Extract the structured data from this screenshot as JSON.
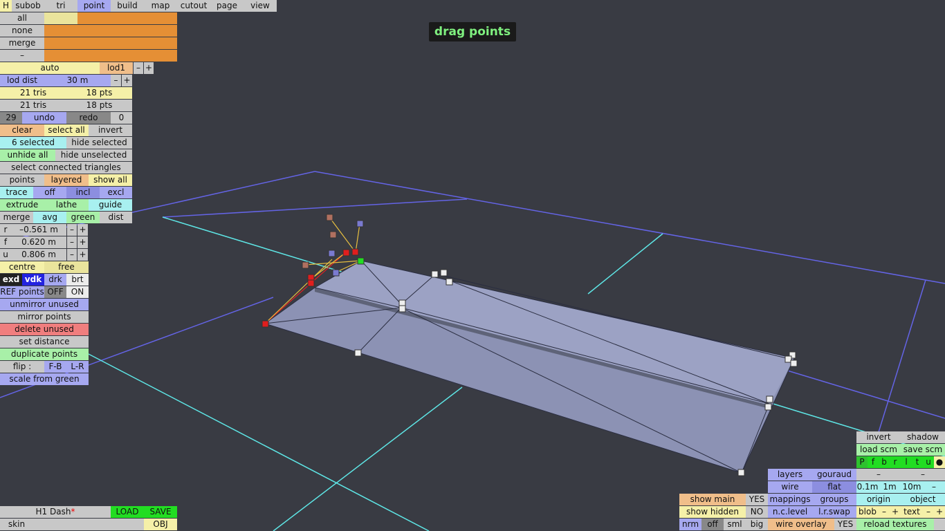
{
  "tabs": [
    "H",
    "subob",
    "tri",
    "point",
    "build",
    "map",
    "cutout",
    "page",
    "view"
  ],
  "selection_rows": [
    "all",
    "none",
    "merge",
    "–"
  ],
  "lod": {
    "auto": "auto",
    "level": "lod1",
    "dist_label": "lod dist",
    "dist_value": "30 m",
    "minus": "–",
    "plus": "+"
  },
  "stats": {
    "tris_a": "21 tris",
    "pts_a": "18 pts",
    "tris_b": "21 tris",
    "pts_b": "18 pts"
  },
  "undo": {
    "count": "29",
    "undo": "undo",
    "redo": "redo",
    "redo_count": "0"
  },
  "actions": {
    "clear": "clear",
    "select_all": "select all",
    "invert": "invert",
    "selected": "6 selected",
    "hide_selected": "hide selected",
    "unhide_all": "unhide all",
    "hide_unselected": "hide unselected",
    "select_connected": "select connected triangles",
    "points": "points",
    "layered": "layered",
    "show_all": "show all",
    "trace": "trace",
    "off": "off",
    "incl": "incl",
    "excl": "excl",
    "extrude": "extrude",
    "lathe": "lathe",
    "guide": "guide",
    "merge": "merge",
    "avg": "avg",
    "green": "green",
    "dist": "dist"
  },
  "coords": [
    {
      "axis": "r",
      "value": "–0.561 m"
    },
    {
      "axis": "f",
      "value": "0.620 m"
    },
    {
      "axis": "u",
      "value": "0.806 m"
    }
  ],
  "mode": {
    "centre": "centre",
    "free": "free",
    "exd": "exd",
    "vdk": "vdk",
    "drk": "drk",
    "brt": "brt",
    "ref_points": "REF points",
    "ref_off": "OFF",
    "ref_on": "ON"
  },
  "tools": {
    "unmirror": "unmirror unused",
    "mirror": "mirror points",
    "delete_unused": "delete unused",
    "set_distance": "set distance",
    "duplicate": "duplicate points",
    "flip": "flip :",
    "fb": "F-B",
    "lr": "L-R",
    "scale": "scale from green"
  },
  "status_label": "drag points",
  "file": {
    "name": "H1 Dash",
    "modified_mark": "*",
    "load": "LOAD",
    "save": "SAVE",
    "skin": "skin",
    "obj": "OBJ"
  },
  "bottom_right": {
    "invert": "invert",
    "shadow": "shadow",
    "load_scm": "load scm",
    "save_scm": "save scm",
    "views": [
      "P",
      "f",
      "b",
      "r",
      "l",
      "t",
      "u",
      "●"
    ],
    "dash1": "–",
    "dash2": "–",
    "layers": "layers",
    "gouraud": "gouraud",
    "wire": "wire",
    "flat": "flat",
    "grid": [
      "0.1m",
      "1m",
      "10m",
      "–"
    ],
    "show_main": "show main",
    "show_main_val": "YES",
    "mappings": "mappings",
    "groups": "groups",
    "origin": "origin",
    "object": "object",
    "show_hidden": "show hidden",
    "show_hidden_val": "NO",
    "nc_level": "n.c.level",
    "lr_swap": "l.r.swap",
    "blob": "blob",
    "text": "text",
    "nrm": "nrm",
    "off": "off",
    "sml": "sml",
    "big": "big",
    "wire_overlay": "wire overlay",
    "wire_overlay_val": "YES",
    "reload": "reload textures"
  },
  "colors": {
    "background": "#393b43",
    "grid_blue": "#6464e6",
    "grid_cyan": "#5ee6e6",
    "mesh": "#8c92b4",
    "selected_point": "#e01e1e",
    "active_point": "#22dd22"
  }
}
